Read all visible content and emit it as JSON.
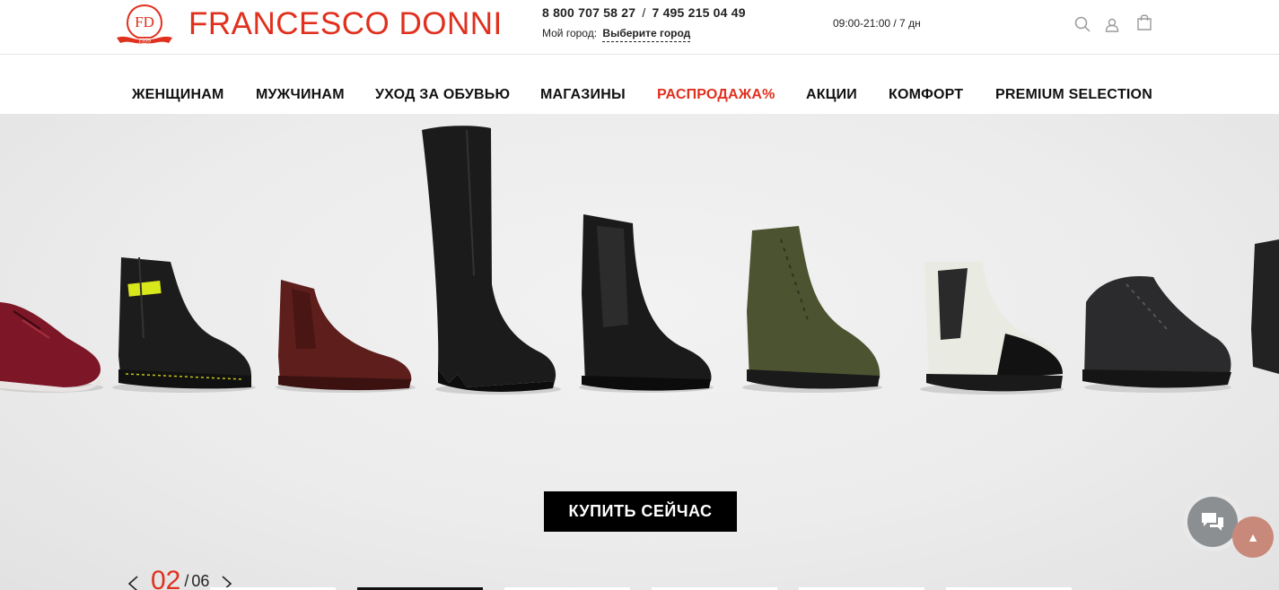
{
  "brand": {
    "name": "FRANCESCO DONNI",
    "badge_letters": "FD",
    "badge_year": "1999",
    "color": "#e0301e"
  },
  "header": {
    "phone_1": "8 800 707 58 27",
    "phone_separator": "/",
    "phone_2": "7 495 215 04 49",
    "city_label": "Мой город:",
    "city_link": "Выберите город",
    "hours": "09:00-21:00 / 7 дн",
    "icons": [
      "search-icon",
      "user-icon",
      "cart-icon"
    ]
  },
  "nav": {
    "items": [
      {
        "label": "ЖЕНЩИНАМ"
      },
      {
        "label": "МУЖЧИНАМ"
      },
      {
        "label": "УХОД ЗА ОБУВЬЮ"
      },
      {
        "label": "МАГАЗИНЫ"
      },
      {
        "label": "РАСПРОДАЖА%"
      },
      {
        "label": "АКЦИИ"
      },
      {
        "label": "КОМФОРТ"
      },
      {
        "label": "PREMIUM SELECTION"
      }
    ],
    "sale_color": "#e0301e"
  },
  "hero": {
    "cta_label": "КУПИТЬ СЕЙЧАС",
    "slide_current": "02",
    "slide_separator": "/",
    "slide_total": "06",
    "active_dot_index": 1,
    "products": [
      "sneaker-burgundy",
      "boot-black-yellow-strap",
      "chelsea-brown",
      "tall-boot-black",
      "chelsea-black",
      "lace-boot-olive",
      "chelsea-white",
      "sneaker-black",
      "boot-black-partial"
    ]
  },
  "widgets": {
    "chat_icon": "chat-icon",
    "scroll_top_icon": "arrow-up-icon"
  }
}
